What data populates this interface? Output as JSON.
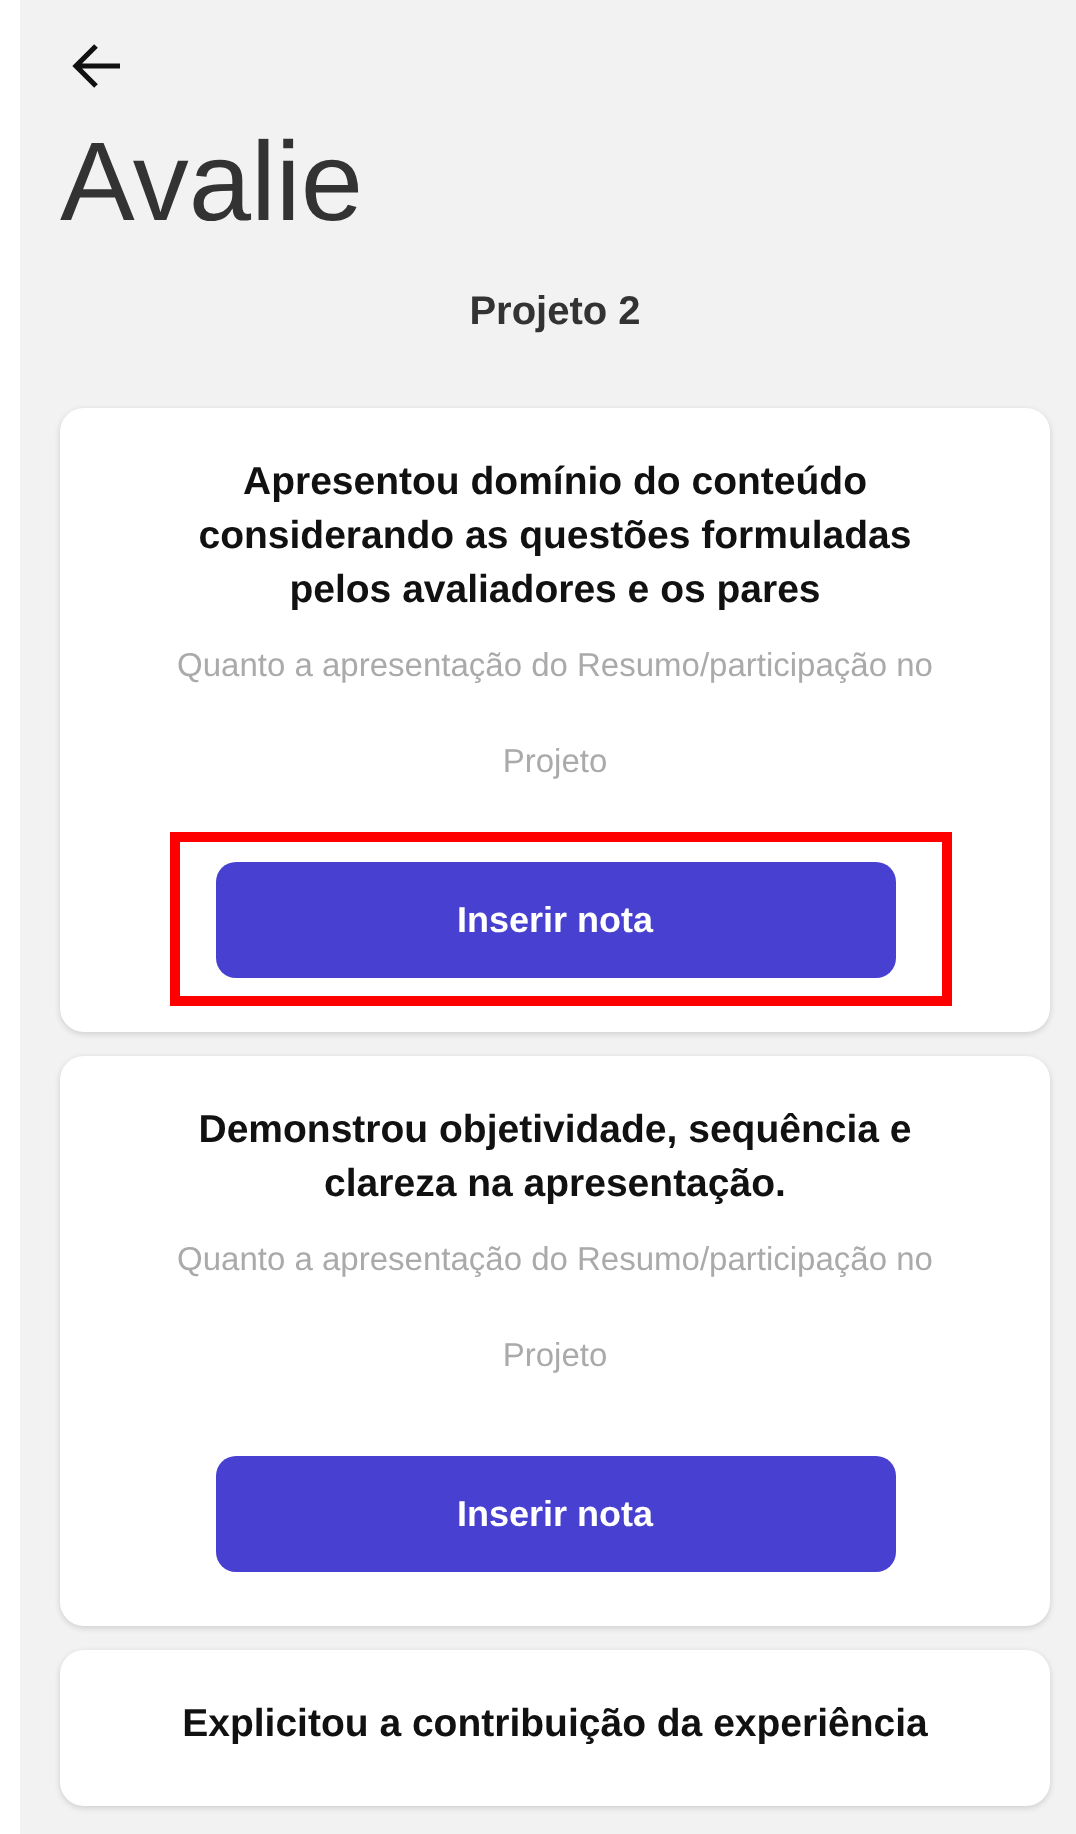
{
  "header": {
    "title": "Avalie",
    "subtitle": "Projeto 2"
  },
  "criteria": [
    {
      "title": "Apresentou domínio do conteúdo considerando as questões formuladas pelos avaliadores e os pares",
      "description": "Quanto a apresentação do Resumo/participação no Projeto",
      "button": "Inserir nota",
      "highlighted": true
    },
    {
      "title": "Demonstrou objetividade, sequência e clareza na apresentação.",
      "description": "Quanto a apresentação do Resumo/participação no Projeto",
      "button": "Inserir nota",
      "highlighted": false
    },
    {
      "title": "Explicitou a contribuição da experiência"
    }
  ]
}
